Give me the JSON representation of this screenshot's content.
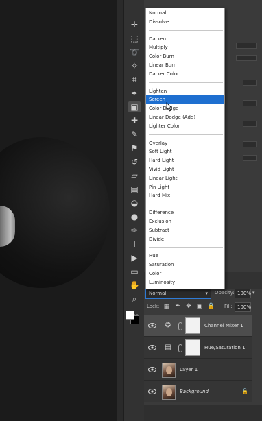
{
  "blend_modes": {
    "groups": [
      [
        "Normal",
        "Dissolve"
      ],
      [
        "Darken",
        "Multiply",
        "Color Burn",
        "Linear Burn",
        "Darker Color"
      ],
      [
        "Lighten",
        "Screen",
        "Color Dodge",
        "Linear Dodge (Add)",
        "Lighter Color"
      ],
      [
        "Overlay",
        "Soft Light",
        "Hard Light",
        "Vivid Light",
        "Linear Light",
        "Pin Light",
        "Hard Mix"
      ],
      [
        "Difference",
        "Exclusion",
        "Subtract",
        "Divide"
      ],
      [
        "Hue",
        "Saturation",
        "Color",
        "Luminosity"
      ]
    ],
    "highlighted": "Screen"
  },
  "layers_panel": {
    "blend_mode_value": "Normal",
    "opacity_label": "Opacity:",
    "opacity_value": "100%",
    "lock_label": "Lock:",
    "fill_label": "Fill:",
    "fill_value": "100%",
    "layers": [
      {
        "name": "Channel Mixer 1",
        "kind": "adjustment",
        "icon": "channel-mixer-icon",
        "selected": true
      },
      {
        "name": "Hue/Saturation 1",
        "kind": "adjustment",
        "icon": "hue-saturation-icon",
        "selected": false
      },
      {
        "name": "Layer 1",
        "kind": "pixel",
        "selected": false
      },
      {
        "name": "Background",
        "kind": "background",
        "locked": true,
        "selected": false
      }
    ]
  },
  "toolbar": {
    "tools": [
      "move-tool-icon",
      "marquee-tool-icon",
      "lasso-tool-icon",
      "magic-wand-tool-icon",
      "crop-tool-icon",
      "eyedropper-tool-icon",
      "frame-tool-icon",
      "healing-brush-icon",
      "brush-tool-icon",
      "clone-stamp-icon",
      "history-brush-icon",
      "eraser-tool-icon",
      "gradient-tool-icon",
      "blur-tool-icon",
      "dodge-tool-icon",
      "pen-tool-icon",
      "type-tool-icon",
      "path-selection-icon",
      "rectangle-tool-icon",
      "hand-tool-icon",
      "zoom-tool-icon",
      "more-tools-icon"
    ],
    "active_tool": "frame-tool-icon",
    "foreground_color": "#ffffff",
    "background_color": "#000000"
  },
  "colors": {
    "highlight_blue": "#1e6fd0",
    "panel_bg": "#3a3a3a",
    "canvas_bg": "#1b1b1b"
  }
}
